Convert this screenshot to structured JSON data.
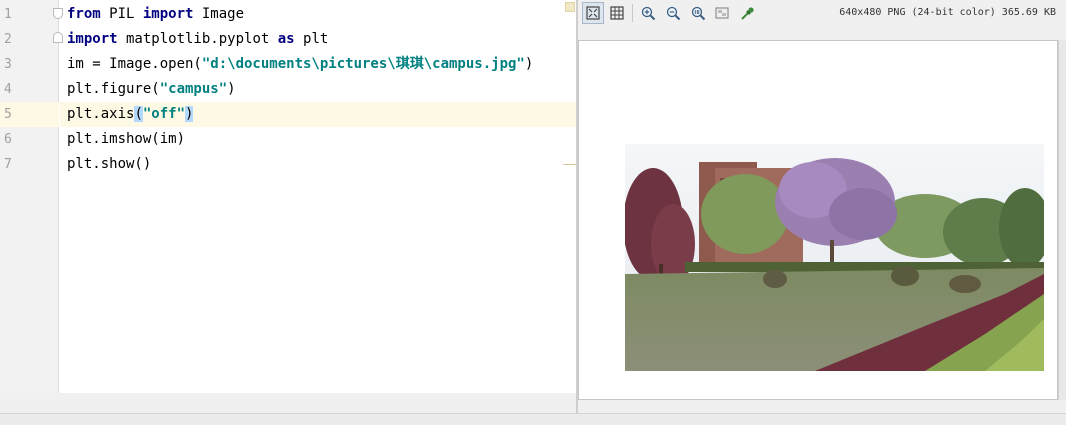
{
  "editor": {
    "line_numbers": [
      "1",
      "2",
      "3",
      "4",
      "5",
      "6",
      "7"
    ],
    "lines": [
      [
        {
          "t": "from",
          "c": "kw"
        },
        {
          "t": " PIL "
        },
        {
          "t": "import",
          "c": "kw"
        },
        {
          "t": " Image"
        }
      ],
      [
        {
          "t": "import",
          "c": "kw"
        },
        {
          "t": " matplotlib.pyplot "
        },
        {
          "t": "as",
          "c": "kw"
        },
        {
          "t": " plt"
        }
      ],
      [
        {
          "t": "im = Image.open("
        },
        {
          "t": "\"d:\\documents\\pictures\\琪琪\\campus.jpg\"",
          "c": "str"
        },
        {
          "t": ")"
        }
      ],
      [
        {
          "t": "plt.figure("
        },
        {
          "t": "\"campus\"",
          "c": "str"
        },
        {
          "t": ")"
        }
      ],
      [
        {
          "t": "plt.axis"
        },
        {
          "t": "(",
          "c": "match"
        },
        {
          "t": "\"off\"",
          "c": "str"
        },
        {
          "t": ")",
          "c": "match"
        }
      ],
      [
        {
          "t": "plt.imshow(im)"
        }
      ],
      [
        {
          "t": "plt.show()"
        }
      ]
    ],
    "current_line": 5
  },
  "viewer": {
    "toolbar": {
      "buttons": [
        "fit-to-window-icon",
        "grid-icon",
        "zoom-in-icon",
        "zoom-out-icon",
        "actual-size-icon",
        "background-icon",
        "color-picker-icon"
      ]
    },
    "image_info": "640x480 PNG (24-bit color) 365.69 KB"
  },
  "colors": {
    "keyword": "#000080",
    "string": "#008080",
    "current_line": "#fdf9e4",
    "brace_match": "#b5d8ff"
  }
}
